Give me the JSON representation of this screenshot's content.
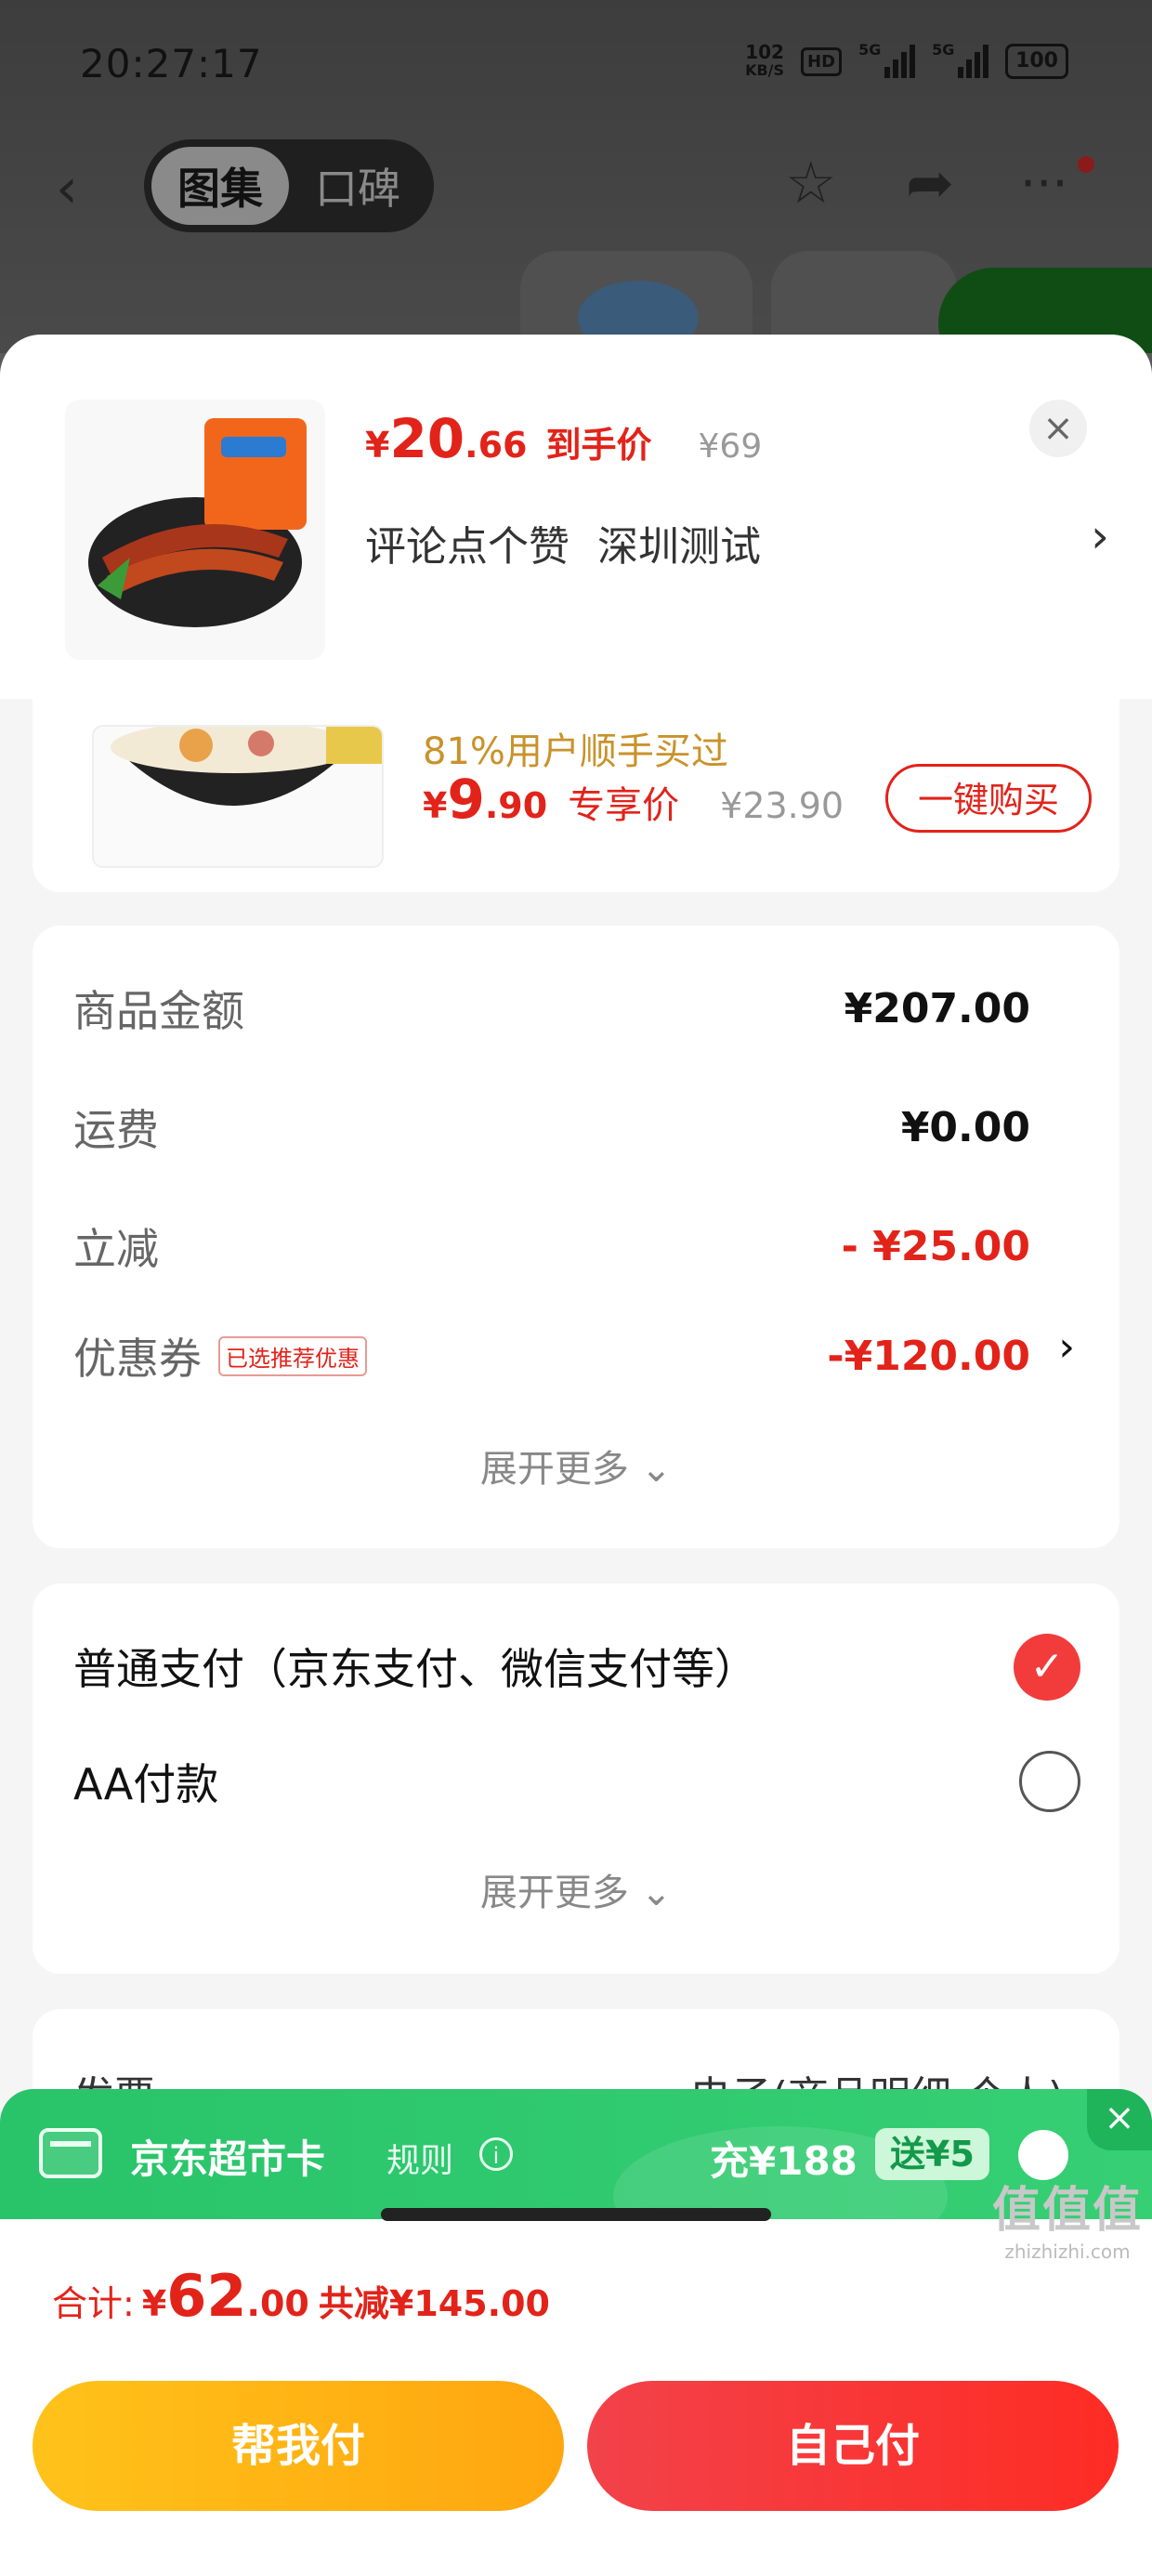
{
  "status_bar": {
    "time": "20:27:17",
    "net_speed_value": "102",
    "net_speed_unit": "KB/S",
    "hd": "HD",
    "sim1": "5G",
    "sim2": "5G",
    "battery": "100"
  },
  "top_nav": {
    "back_icon": "chevron-left-icon",
    "tab_gallery": "图集",
    "tab_reviews": "口碑",
    "star_icon": "star-icon",
    "share_icon": "share-icon",
    "more_icon": "more-icon"
  },
  "product": {
    "price_symbol": "¥",
    "price_int": "20",
    "price_dec": ".66",
    "price_tag": "到手价",
    "original_price": "¥69",
    "spec_1": "评论点个赞",
    "spec_2": "深圳测试"
  },
  "recommend": {
    "subtitle": "81%用户顺手买过",
    "price_symbol": "¥",
    "price_int": "9",
    "price_dec": ".90",
    "price_tag": "专享价",
    "original_price": "¥23.90",
    "buy_label": "一键购买"
  },
  "summary": {
    "rows": [
      {
        "label": "商品金额",
        "value": "¥207.00"
      },
      {
        "label": "运费",
        "value": "¥0.00"
      },
      {
        "label": "立减",
        "value": "- ¥25.00"
      },
      {
        "label": "优惠券",
        "tag": "已选推荐优惠",
        "value": "-¥120.00"
      }
    ],
    "expand_label": "展开更多"
  },
  "payment": {
    "option_1": "普通支付（京东支付、微信支付等）",
    "option_2": "AA付款",
    "expand_label": "展开更多"
  },
  "invoice": {
    "label": "发票",
    "value": "电子(商品明细-个人)"
  },
  "promo": {
    "title": "京东超市卡",
    "rule": "规则",
    "charge": "充¥188",
    "gift": "送¥5"
  },
  "total": {
    "label": "合计:",
    "symbol": "¥",
    "int": "62",
    "dec": ".00",
    "discount": "共减¥145.00"
  },
  "actions": {
    "help_pay": "帮我付",
    "self_pay": "自己付"
  },
  "watermark": {
    "big": "值值值",
    "small": "zhizhizhi.com"
  },
  "colors": {
    "accent_red": "#e2231a",
    "promo_green": "#2fc86e",
    "help_button": "#ffb415",
    "self_button": "#f53a38"
  }
}
